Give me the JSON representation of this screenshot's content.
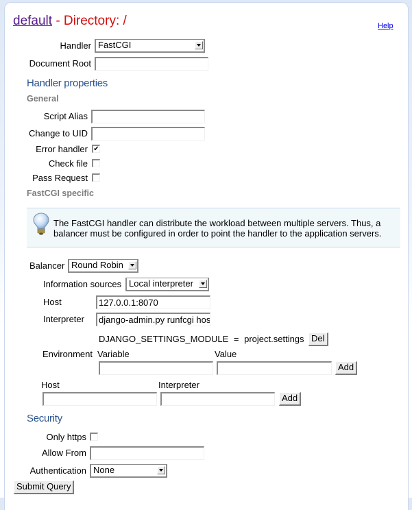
{
  "header": {
    "vserver_link": "default",
    "title_rest": " - Directory: /",
    "help_link": "Help"
  },
  "form": {
    "handler": {
      "label": "Handler",
      "value": "FastCGI"
    },
    "document_root": {
      "label": "Document Root",
      "value": ""
    },
    "handler_properties_title": "Handler properties",
    "general_title": "General",
    "script_alias": {
      "label": "Script Alias",
      "value": ""
    },
    "change_uid": {
      "label": "Change to UID",
      "value": ""
    },
    "error_handler": {
      "label": "Error handler",
      "checked": true,
      "mark": "✔"
    },
    "check_file": {
      "label": "Check file",
      "checked": false
    },
    "pass_request": {
      "label": "Pass Request",
      "checked": false
    },
    "fastcgi_title": "FastCGI specific",
    "notice": {
      "icon": "lightbulb-icon",
      "text": "The FastCGI handler can distribute the workload between multiple servers. Thus, a balancer must be configured in order to point the handler to the application servers."
    },
    "balancer": {
      "label": "Balancer",
      "value": "Round Robin"
    },
    "info_sources": {
      "label": "Information sources",
      "value": "Local interpreter"
    },
    "host": {
      "label": "Host",
      "value": "127.0.0.1:8070"
    },
    "interpreter": {
      "label": "Interpreter",
      "value": "django-admin.py runfcgi hos"
    },
    "environment": {
      "label": "Environment",
      "entries": [
        {
          "variable": "DJANGO_SETTINGS_MODULE",
          "eq": "=",
          "value": "project.settings",
          "delete_label": "Del"
        }
      ],
      "variable_header": "Variable",
      "value_header": "Value",
      "add_label": "Add"
    },
    "new_source": {
      "host_header": "Host",
      "interpreter_header": "Interpreter",
      "add_label": "Add"
    },
    "security_title": "Security",
    "only_https": {
      "label": "Only https",
      "checked": false
    },
    "allow_from": {
      "label": "Allow From",
      "value": ""
    },
    "authentication": {
      "label": "Authentication",
      "value": "None"
    },
    "submit_label": "Submit Query"
  }
}
